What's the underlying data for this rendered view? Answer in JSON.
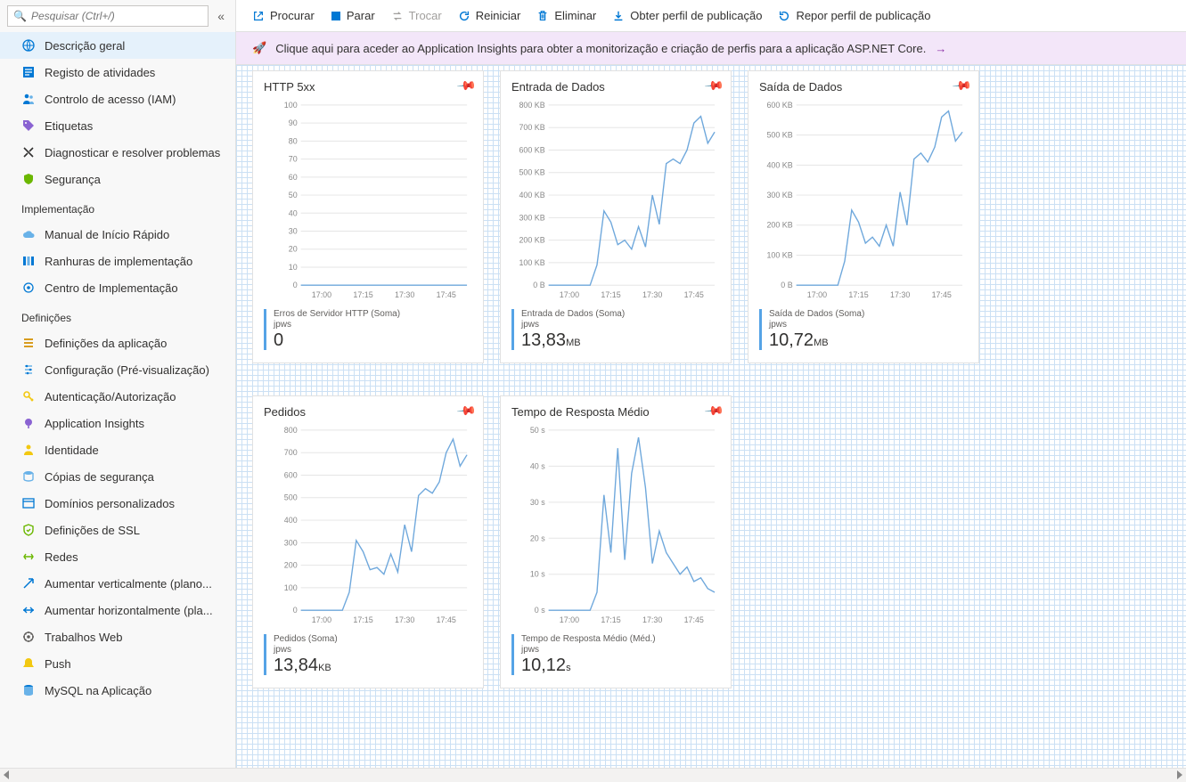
{
  "search": {
    "placeholder": "Pesquisar (Ctrl+/)"
  },
  "sidebar": {
    "items": [
      {
        "label": "Descrição geral",
        "icon": "globe-icon",
        "active": true
      },
      {
        "label": "Registo de atividades",
        "icon": "log-icon"
      },
      {
        "label": "Controlo de acesso (IAM)",
        "icon": "people-icon"
      },
      {
        "label": "Etiquetas",
        "icon": "tag-icon"
      },
      {
        "label": "Diagnosticar e resolver problemas",
        "icon": "tools-icon"
      },
      {
        "label": "Segurança",
        "icon": "shield-icon"
      }
    ],
    "section_impl": "Implementação",
    "impl_items": [
      {
        "label": "Manual de Início Rápido",
        "icon": "cloud-icon"
      },
      {
        "label": "Ranhuras de implementação",
        "icon": "slots-icon"
      },
      {
        "label": "Centro de Implementação",
        "icon": "deploy-center-icon"
      }
    ],
    "section_def": "Definições",
    "def_items": [
      {
        "label": "Definições da aplicação",
        "icon": "settings-list-icon"
      },
      {
        "label": "Configuração (Pré-visualização)",
        "icon": "config-icon"
      },
      {
        "label": "Autenticação/Autorização",
        "icon": "key-icon"
      },
      {
        "label": "Application Insights",
        "icon": "insights-icon"
      },
      {
        "label": "Identidade",
        "icon": "identity-icon"
      },
      {
        "label": "Cópias de segurança",
        "icon": "backup-icon"
      },
      {
        "label": "Domínios personalizados",
        "icon": "domain-icon"
      },
      {
        "label": "Definições de SSL",
        "icon": "ssl-icon"
      },
      {
        "label": "Redes",
        "icon": "network-icon"
      },
      {
        "label": "Aumentar verticalmente (plano...",
        "icon": "scale-up-icon"
      },
      {
        "label": "Aumentar horizontalmente (pla...",
        "icon": "scale-out-icon"
      },
      {
        "label": "Trabalhos Web",
        "icon": "webjobs-icon"
      },
      {
        "label": "Push",
        "icon": "push-icon"
      },
      {
        "label": "MySQL na Aplicação",
        "icon": "mysql-icon"
      }
    ]
  },
  "toolbar": {
    "browse": "Procurar",
    "stop": "Parar",
    "swap": "Trocar",
    "restart": "Reiniciar",
    "delete": "Eliminar",
    "get_profile": "Obter perfil de publicação",
    "reset_profile": "Repor perfil de publicação"
  },
  "banner": {
    "text": "Clique aqui para aceder ao Application Insights para obter a monitorização e criação de perfis para a aplicação ASP.NET Core."
  },
  "x_ticks": [
    "17:00",
    "17:15",
    "17:30",
    "17:45"
  ],
  "cards": {
    "http5xx": {
      "title": "HTTP 5xx",
      "metric_label": "Erros de Servidor HTTP (Soma)",
      "metric_sub": "jpws",
      "metric_value": "0",
      "metric_unit": ""
    },
    "data_in": {
      "title": "Entrada de Dados",
      "metric_label": "Entrada de Dados (Soma)",
      "metric_sub": "jpws",
      "metric_value": "13,83",
      "metric_unit": "MB"
    },
    "data_out": {
      "title": "Saída de Dados",
      "metric_label": "Saída de Dados (Soma)",
      "metric_sub": "jpws",
      "metric_value": "10,72",
      "metric_unit": "MB"
    },
    "requests": {
      "title": "Pedidos",
      "metric_label": "Pedidos (Soma)",
      "metric_sub": "jpws",
      "metric_value": "13,84",
      "metric_unit": "KB"
    },
    "response": {
      "title": "Tempo de Resposta Médio",
      "metric_label": "Tempo de Resposta Médio (Méd.)",
      "metric_sub": "jpws",
      "metric_value": "10,12",
      "metric_unit": "s"
    }
  },
  "chart_data": [
    {
      "id": "http5xx",
      "type": "line",
      "title": "HTTP 5xx",
      "ylabel": "",
      "ylim": [
        0,
        100
      ],
      "y_ticks": [
        "0",
        "10",
        "20",
        "30",
        "40",
        "50",
        "60",
        "70",
        "80",
        "90",
        "100"
      ],
      "x": [
        "17:00",
        "17:15",
        "17:30",
        "17:45"
      ],
      "series": [
        {
          "name": "Erros de Servidor HTTP",
          "values": [
            0,
            0,
            0,
            0,
            0,
            0,
            0,
            0,
            0,
            0,
            0,
            0,
            0,
            0,
            0,
            0,
            0,
            0,
            0,
            0
          ]
        }
      ]
    },
    {
      "id": "data_in",
      "type": "line",
      "title": "Entrada de Dados",
      "ylabel": "KB",
      "ylim": [
        0,
        800
      ],
      "y_ticks": [
        "0 B",
        "100 KB",
        "200 KB",
        "300 KB",
        "400 KB",
        "500 KB",
        "600 KB",
        "700 KB",
        "800 KB"
      ],
      "x": [
        "17:00",
        "17:15",
        "17:30",
        "17:45"
      ],
      "series": [
        {
          "name": "Entrada de Dados",
          "values": [
            0,
            0,
            0,
            0,
            0,
            0,
            0,
            90,
            330,
            280,
            180,
            200,
            160,
            260,
            170,
            400,
            270,
            540,
            560,
            540,
            600,
            720,
            750,
            630,
            680
          ]
        }
      ]
    },
    {
      "id": "data_out",
      "type": "line",
      "title": "Saída de Dados",
      "ylabel": "KB",
      "ylim": [
        0,
        600
      ],
      "y_ticks": [
        "0 B",
        "100 KB",
        "200 KB",
        "300 KB",
        "400 KB",
        "500 KB",
        "600 KB"
      ],
      "x": [
        "17:00",
        "17:15",
        "17:30",
        "17:45"
      ],
      "series": [
        {
          "name": "Saída de Dados",
          "values": [
            0,
            0,
            0,
            0,
            0,
            0,
            0,
            80,
            250,
            210,
            140,
            160,
            130,
            200,
            130,
            310,
            200,
            420,
            440,
            410,
            460,
            560,
            580,
            480,
            510
          ]
        }
      ]
    },
    {
      "id": "requests",
      "type": "line",
      "title": "Pedidos",
      "ylabel": "",
      "ylim": [
        0,
        800
      ],
      "y_ticks": [
        "0",
        "100",
        "200",
        "300",
        "400",
        "500",
        "600",
        "700",
        "800"
      ],
      "x": [
        "17:00",
        "17:15",
        "17:30",
        "17:45"
      ],
      "series": [
        {
          "name": "Pedidos",
          "values": [
            0,
            0,
            0,
            0,
            0,
            0,
            0,
            80,
            310,
            260,
            180,
            190,
            160,
            250,
            170,
            380,
            260,
            510,
            540,
            520,
            570,
            700,
            760,
            640,
            690
          ]
        }
      ]
    },
    {
      "id": "response",
      "type": "line",
      "title": "Tempo de Resposta Médio",
      "ylabel": "s",
      "ylim": [
        0,
        50
      ],
      "y_ticks": [
        "0 s",
        "10 s",
        "20 s",
        "30 s",
        "40 s",
        "50 s"
      ],
      "x": [
        "17:00",
        "17:15",
        "17:30",
        "17:45"
      ],
      "series": [
        {
          "name": "Tempo de Resposta Médio",
          "values": [
            0,
            0,
            0,
            0,
            0,
            0,
            0,
            5,
            32,
            16,
            45,
            14,
            38,
            48,
            34,
            13,
            22,
            16,
            13,
            10,
            12,
            8,
            9,
            6,
            5
          ]
        }
      ]
    }
  ]
}
